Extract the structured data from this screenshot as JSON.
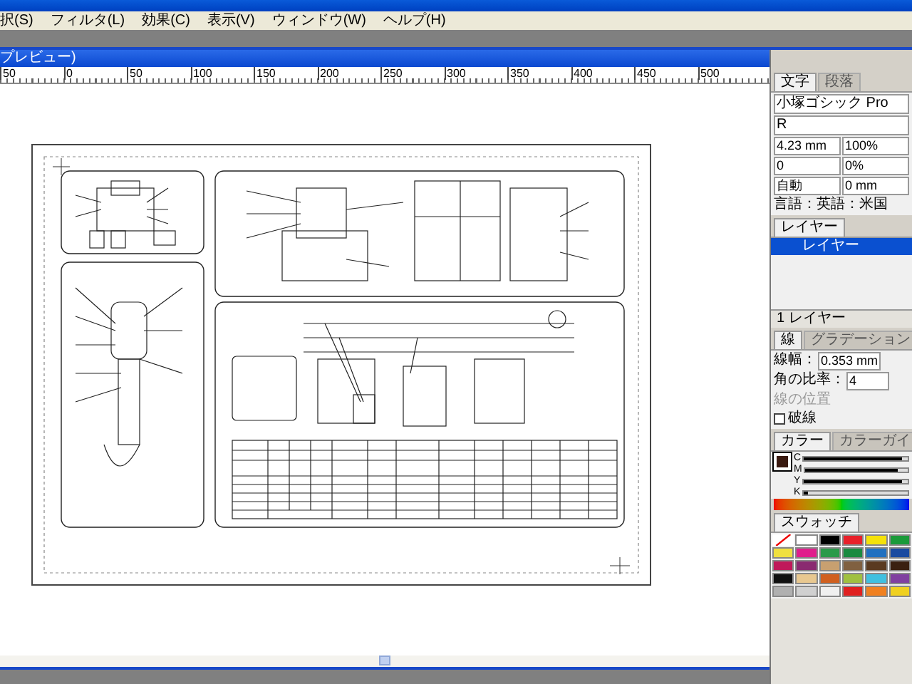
{
  "menu_bar": [
    "択(S)",
    "フィルタ(L)",
    "効果(C)",
    "表示(V)",
    "ウィンドウ(W)",
    "ヘルプ(H)"
  ],
  "document": {
    "title": "プレビュー)"
  },
  "ruler": [
    "50",
    "0",
    "50",
    "100",
    "150",
    "200",
    "250",
    "300",
    "350",
    "400",
    "450",
    "500"
  ],
  "character_panel": {
    "tabs": [
      {
        "label": "文字",
        "selected": true
      },
      {
        "label": "段落",
        "selected": false
      }
    ],
    "font": "小塚ゴシック Pro",
    "style": "R",
    "fields": [
      "4.23 mm",
      "100%",
      "0",
      "0%",
      "自動",
      "0 mm"
    ],
    "language": "言語：英語：米国"
  },
  "layers_panel": {
    "tabs": [
      {
        "label": "レイヤー",
        "selected": true
      }
    ],
    "layers": [
      {
        "name": "レイヤー",
        "selected": true
      }
    ],
    "count": "1 レイヤー"
  },
  "stroke_panel": {
    "tabs": [
      {
        "label": "線",
        "selected": true
      },
      {
        "label": "グラデーション",
        "selected": false
      }
    ],
    "weight_label": "線幅：",
    "weight": "0.353 mm",
    "miter_label": "角の比率：",
    "miter": "4",
    "align_label": "線の位置",
    "dashed": {
      "label": "破線",
      "checked": false
    }
  },
  "color_panel": {
    "tabs": [
      {
        "label": "カラー",
        "selected": true
      },
      {
        "label": "カラーガイ",
        "selected": false
      }
    ],
    "sliders": [
      {
        "label": "C",
        "level": 0.95
      },
      {
        "label": "M",
        "level": 0.9
      },
      {
        "label": "Y",
        "level": 0.95
      },
      {
        "label": "K",
        "level": 0.05
      }
    ]
  },
  "swatches_panel": {
    "tabs": [
      {
        "label": "スウォッチ",
        "selected": true
      }
    ],
    "swatches": [
      {
        "kind": "none",
        "color": "#ffffff"
      },
      {
        "kind": "color",
        "color": "#ffffff"
      },
      {
        "kind": "color",
        "color": "#000000"
      },
      {
        "kind": "color",
        "color": "#e8202a"
      },
      {
        "kind": "color",
        "color": "#f5e20a"
      },
      {
        "kind": "color",
        "color": "#1a9a3a"
      },
      {
        "kind": "color",
        "color": "#f0e040"
      },
      {
        "kind": "color",
        "color": "#e01e8c"
      },
      {
        "kind": "color",
        "color": "#2a9a4a"
      },
      {
        "kind": "color",
        "color": "#1a8a40"
      },
      {
        "kind": "color",
        "color": "#2070c0"
      },
      {
        "kind": "color",
        "color": "#1a4aa0"
      },
      {
        "kind": "color",
        "color": "#c0185a"
      },
      {
        "kind": "color",
        "color": "#8a2a70"
      },
      {
        "kind": "color",
        "color": "#c8a070"
      },
      {
        "kind": "color",
        "color": "#806040"
      },
      {
        "kind": "color",
        "color": "#5a3a20"
      },
      {
        "kind": "color",
        "color": "#3a2010"
      },
      {
        "kind": "color",
        "color": "#101010"
      },
      {
        "kind": "color",
        "color": "#e8c890"
      },
      {
        "kind": "color",
        "color": "#d06020"
      },
      {
        "kind": "color",
        "color": "#a0c040"
      },
      {
        "kind": "color",
        "color": "#40c0e0"
      },
      {
        "kind": "color",
        "color": "#8040a0"
      },
      {
        "kind": "color",
        "color": "#b0b0b0"
      },
      {
        "kind": "color",
        "color": "#d0d0d0"
      },
      {
        "kind": "color",
        "color": "#f0f0f0"
      },
      {
        "kind": "color",
        "color": "#e02020"
      },
      {
        "kind": "color",
        "color": "#f08020"
      },
      {
        "kind": "color",
        "color": "#f0d020"
      }
    ]
  }
}
